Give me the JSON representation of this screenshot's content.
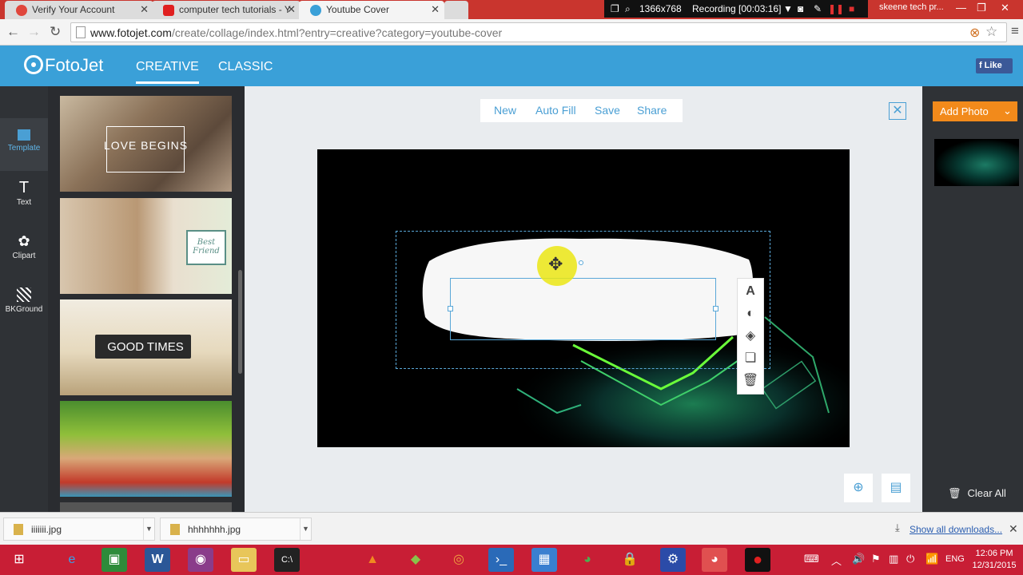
{
  "browser": {
    "tabs": [
      {
        "title": "Verify Your Account"
      },
      {
        "title": "computer tech tutorials - Y"
      },
      {
        "title": "Youtube Cover"
      }
    ],
    "url_host": "www.fotojet.com",
    "url_path": "/create/collage/index.html?entry=creative?category=youtube-cover"
  },
  "recorder": {
    "resolution": "1366x768",
    "status": "Recording [00:03:16]"
  },
  "user_chip": "skeene tech pr...",
  "app": {
    "logo": "FotoJet",
    "nav": [
      "CREATIVE",
      "CLASSIC"
    ],
    "fb_like": "Like"
  },
  "rail": [
    "Template",
    "Text",
    "Clipart",
    "BKGround"
  ],
  "templates": [
    {
      "caption": "LOVE BEGINS"
    },
    {
      "caption": "Best Friend"
    },
    {
      "caption": "GOOD TIMES"
    },
    {
      "caption": ""
    }
  ],
  "actions": [
    "New",
    "Auto Fill",
    "Save",
    "Share"
  ],
  "right_panel": {
    "add_photo": "Add Photo",
    "clear_all": "Clear All"
  },
  "downloads": {
    "files": [
      "iiiiiii.jpg",
      "hhhhhhh.jpg"
    ],
    "show_all": "Show all downloads..."
  },
  "taskbar": {
    "lang": "ENG",
    "time": "12:06 PM",
    "date": "12/31/2015"
  },
  "colors": {
    "accent": "#3aa0d8",
    "orange": "#f28a1b",
    "chrome_red": "#c9352e"
  }
}
